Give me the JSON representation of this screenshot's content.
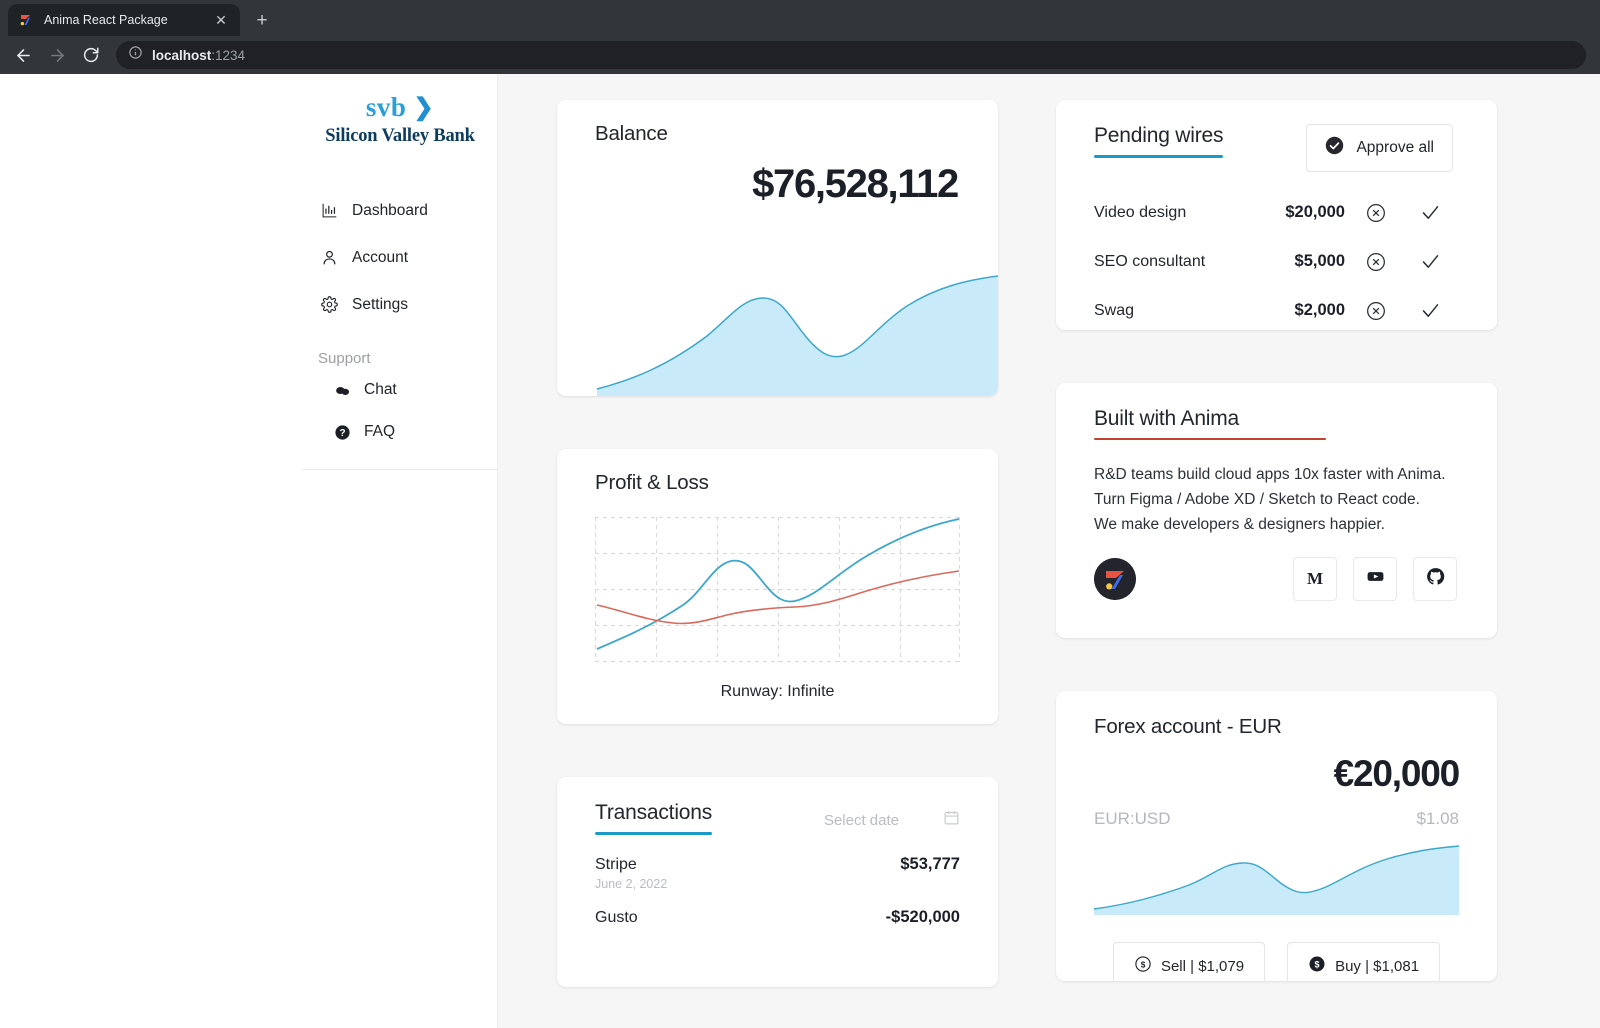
{
  "browser": {
    "tab_title": "Anima React Package",
    "tab_close_glyph": "✕",
    "new_tab_glyph": "+",
    "url_host": "localhost",
    "url_port": ":1234"
  },
  "sidebar": {
    "brand_mark": "svb",
    "brand_chevron": "❯",
    "brand_name": "Silicon Valley Bank",
    "items": [
      {
        "label": "Dashboard",
        "icon": "bar-chart-icon"
      },
      {
        "label": "Account",
        "icon": "person-icon"
      },
      {
        "label": "Settings",
        "icon": "gear-icon"
      }
    ],
    "support_label": "Support",
    "support_items": [
      {
        "label": "Chat",
        "icon": "chat-bubbles-icon"
      },
      {
        "label": "FAQ",
        "icon": "question-circle-icon"
      }
    ]
  },
  "balance": {
    "title": "Balance",
    "amount": "$76,528,112"
  },
  "profit_loss": {
    "title": "Profit & Loss",
    "footer": "Runway: Infinite"
  },
  "transactions": {
    "title": "Transactions",
    "accent": "#1a9bc7",
    "date_placeholder": "Select date",
    "rows": [
      {
        "name": "Stripe",
        "amount": "$53,777",
        "date": "June 2, 2022"
      },
      {
        "name": "Gusto",
        "amount": "-$520,000",
        "date": ""
      }
    ]
  },
  "pending_wires": {
    "title": "Pending wires",
    "accent": "#1a9bc7",
    "approve_all_label": "Approve all",
    "rows": [
      {
        "name": "Video design",
        "amount": "$20,000"
      },
      {
        "name": "SEO consultant",
        "amount": "$5,000"
      },
      {
        "name": "Swag",
        "amount": "$2,000"
      }
    ]
  },
  "anima": {
    "title": "Built with Anima",
    "accent": "#c0432f",
    "body_lines": [
      "R&D teams build cloud apps 10x faster with Anima.",
      "Turn Figma / Adobe XD / Sketch to React code.",
      "We make developers & designers happier."
    ],
    "social": [
      {
        "name": "medium",
        "glyph": "M"
      },
      {
        "name": "youtube",
        "glyph": ""
      },
      {
        "name": "github",
        "glyph": ""
      }
    ]
  },
  "forex": {
    "title": "Forex account - EUR",
    "amount": "€20,000",
    "pair_label": "EUR:USD",
    "pair_rate": "$1.08",
    "sell_label": "Sell | $1,079",
    "buy_label": "Buy | $1,081"
  },
  "chart_data": [
    {
      "type": "area",
      "name": "balance-sparkline",
      "x": [
        0,
        1,
        2,
        3,
        4,
        5,
        6,
        7,
        8
      ],
      "values": [
        6,
        14,
        28,
        52,
        74,
        66,
        48,
        72,
        96
      ],
      "ylim": [
        0,
        100
      ],
      "grid": false,
      "line_color": "#3ba7cd",
      "fill_color": "#c9ebf9"
    },
    {
      "type": "line",
      "name": "profit-loss",
      "title": "Profit & Loss",
      "x": [
        0,
        1,
        2,
        3,
        4,
        5,
        6,
        7,
        8
      ],
      "series": [
        {
          "name": "profit",
          "values": [
            8,
            22,
            38,
            62,
            72,
            60,
            56,
            78,
            96
          ],
          "color": "#3ba7cd"
        },
        {
          "name": "loss",
          "values": [
            44,
            34,
            29,
            31,
            38,
            41,
            43,
            52,
            64
          ],
          "color": "#d9695c"
        }
      ],
      "ylim": [
        0,
        100
      ],
      "grid": true,
      "grid_color": "#d8d8d8",
      "grid_rows": 4,
      "grid_cols": 6
    },
    {
      "type": "area",
      "name": "forex-sparkline",
      "x": [
        0,
        1,
        2,
        3,
        4,
        5,
        6,
        7,
        8
      ],
      "values": [
        8,
        18,
        34,
        56,
        70,
        60,
        50,
        74,
        94
      ],
      "ylim": [
        0,
        100
      ],
      "grid": false,
      "line_color": "#3ba7cd",
      "fill_color": "#c9ebf9"
    }
  ]
}
